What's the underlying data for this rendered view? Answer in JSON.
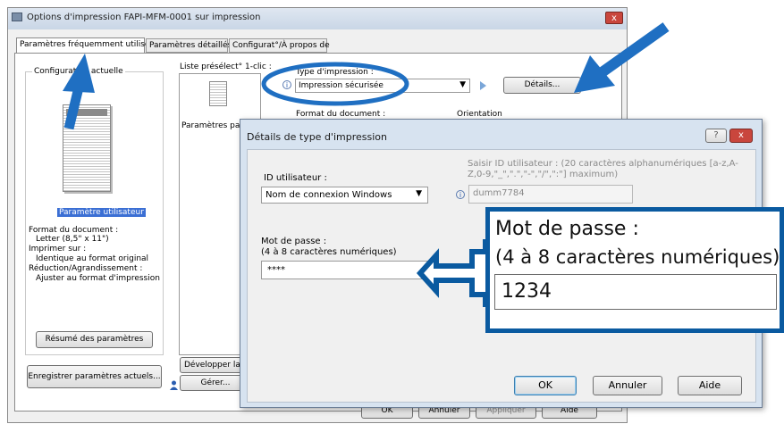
{
  "main_window": {
    "title": "Options d'impression FAPI-MFM-0001 sur impression",
    "close_label": "x",
    "tabs": [
      "Paramètres fréquemment utilisés",
      "Paramètres détaillés",
      "Configurat°/À propos de"
    ],
    "current_config_label": "Configuration actuelle",
    "user_setting_label": "Paramètre utilisateur",
    "config_summary": [
      "Format du document :",
      "Letter (8,5\" x 11\")",
      "Imprimer sur :",
      "Identique au format original",
      "Réduction/Agrandissement :",
      "Ajuster au format d'impression"
    ],
    "summary_button": "Résumé des paramètres",
    "save_settings_button": "Enregistrer paramètres actuels...",
    "preset_list_label": "Liste présélect° 1-clic :",
    "preset_item": "Paramètres par",
    "expand_button": "Développer la li",
    "manage_button": "Gérer...",
    "print_type_label": "Type d'impression :",
    "print_type_value": "Impression sécurisée",
    "details_button": "Détails...",
    "doc_format_label": "Format du document :",
    "orientation_label": "Orientation",
    "bottom_buttons": [
      "OK",
      "Annuler",
      "Appliquer",
      "Aide"
    ]
  },
  "dialog": {
    "title": "Détails de type d'impression",
    "help_label": "?",
    "close_label": "x",
    "user_id_label": "ID utilisateur :",
    "user_id_select": "Nom de connexion Windows",
    "enter_id_hint": "Saisir ID utilisateur : (20 caractères alphanumériques [a-z,A-Z,0-9,\"_\",\".\",\"-\",\"/\",\":\"] maximum)",
    "user_id_value": "dumm7784",
    "password_label_1": "Mot de passe :",
    "password_label_2": "(4 à 8 caractères numériques)",
    "password_value": "****",
    "ok_button": "OK",
    "cancel_button": "Annuler",
    "help_button": "Aide"
  },
  "zoom_callout": {
    "label_1": "Mot de passe :",
    "label_2": "(4 à 8 caractères numériques)",
    "value": "1234"
  },
  "colors": {
    "annotation_blue": "#1f6fc2",
    "callout_border": "#0a5aa0",
    "highlight_blue": "#3b6fd4"
  }
}
